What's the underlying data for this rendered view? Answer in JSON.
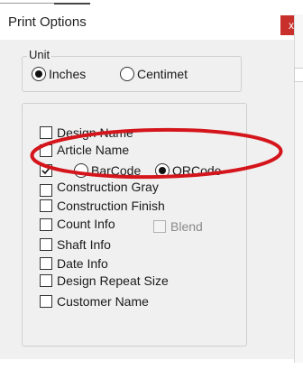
{
  "window": {
    "title": "Print Options",
    "close_glyph": "x"
  },
  "unit_group": {
    "label": "Unit",
    "options": [
      {
        "label": "Inches",
        "selected": true
      },
      {
        "label": "Centimet",
        "selected": false
      }
    ]
  },
  "items": {
    "design_name": "Design Name",
    "article_name": "Article Name",
    "barcode": "BarCode",
    "qrcode": "QRCode",
    "construction_gray": "Construction Gray",
    "construction_finish": "Construction Finish",
    "count_info": "Count Info",
    "blend": "Blend",
    "shaft_info": "Shaft Info",
    "date_info": "Date Info",
    "design_repeat_size": "Design Repeat Size",
    "customer_name": "Customer Name"
  },
  "colors": {
    "close_button": "#c8302c",
    "annotation_ellipse": "#d4151b"
  }
}
